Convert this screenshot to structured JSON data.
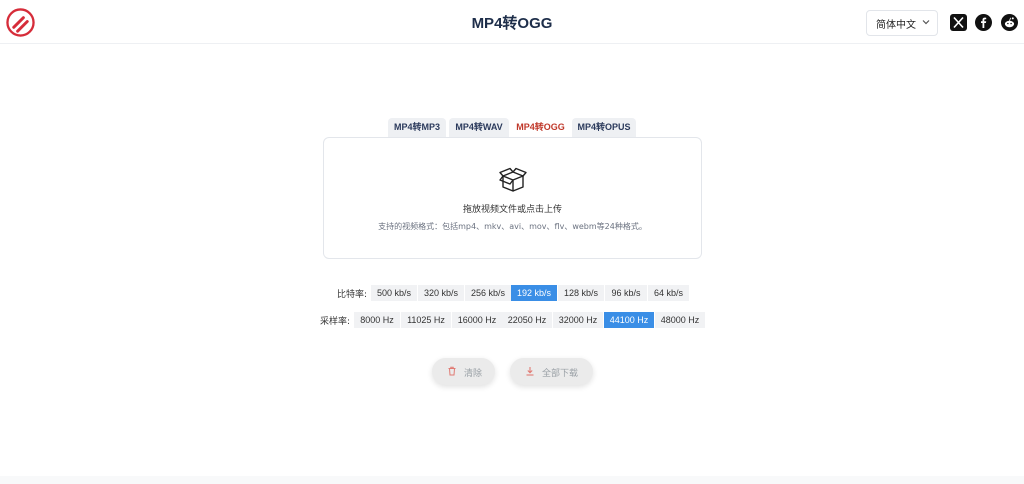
{
  "header": {
    "title": "MP4转OGG",
    "language": "简体中文"
  },
  "tabs": [
    {
      "label": "MP4转MP3",
      "active": false
    },
    {
      "label": "MP4转WAV",
      "active": false
    },
    {
      "label": "MP4转OGG",
      "active": true
    },
    {
      "label": "MP4转OPUS",
      "active": false
    }
  ],
  "upload": {
    "main_text": "拖放视频文件或点击上传",
    "sub_text": "支持的视频格式：包括mp4、mkv、avi、mov、flv、webm等24种格式。"
  },
  "bitrate": {
    "label": "比特率:",
    "options": [
      "500 kb/s",
      "320 kb/s",
      "256 kb/s",
      "192 kb/s",
      "128 kb/s",
      "96 kb/s",
      "64 kb/s"
    ],
    "selected": "192 kb/s"
  },
  "samplerate": {
    "label": "采样率:",
    "options": [
      "8000 Hz",
      "11025 Hz",
      "16000 Hz",
      "22050 Hz",
      "32000 Hz",
      "44100 Hz",
      "48000 Hz"
    ],
    "selected": "44100 Hz"
  },
  "actions": {
    "clear_label": "清除",
    "download_all_label": "全部下载"
  },
  "colors": {
    "accent": "#3a8ee6",
    "active_tab_text": "#c0392b",
    "logo_red": "#d62d3a"
  }
}
